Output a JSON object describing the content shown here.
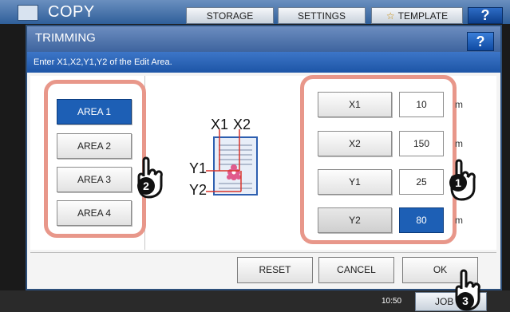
{
  "header": {
    "app_title": "COPY",
    "tabs": [
      "STORAGE",
      "SETTINGS",
      "TEMPLATE"
    ],
    "help_label": "?"
  },
  "dialog": {
    "title": "TRIMMING",
    "help_label": "?",
    "instruction": "Enter X1,X2,Y1,Y2 of the Edit Area.",
    "areas": [
      "AREA 1",
      "AREA 2",
      "AREA 3",
      "AREA 4"
    ],
    "selected_area": "AREA 1",
    "illustration_labels": {
      "x1": "X1",
      "x2": "X2",
      "y1": "Y1",
      "y2": "Y2"
    },
    "params": [
      {
        "label": "X1",
        "value": "10",
        "unit": "m"
      },
      {
        "label": "X2",
        "value": "150",
        "unit": "m"
      },
      {
        "label": "Y1",
        "value": "25",
        "unit": "m"
      },
      {
        "label": "Y2",
        "value": "80",
        "unit": "m"
      }
    ],
    "selected_param": "Y2",
    "buttons": {
      "reset": "RESET",
      "cancel": "CANCEL",
      "ok": "OK"
    }
  },
  "statusbar": {
    "time": "10:50",
    "jobs_label": "JOB"
  },
  "callouts": [
    "1",
    "2",
    "3"
  ],
  "colors": {
    "accent": "#1d5fb5",
    "highlight_outline": "#e8978a",
    "title_bar": "#3e649e"
  }
}
